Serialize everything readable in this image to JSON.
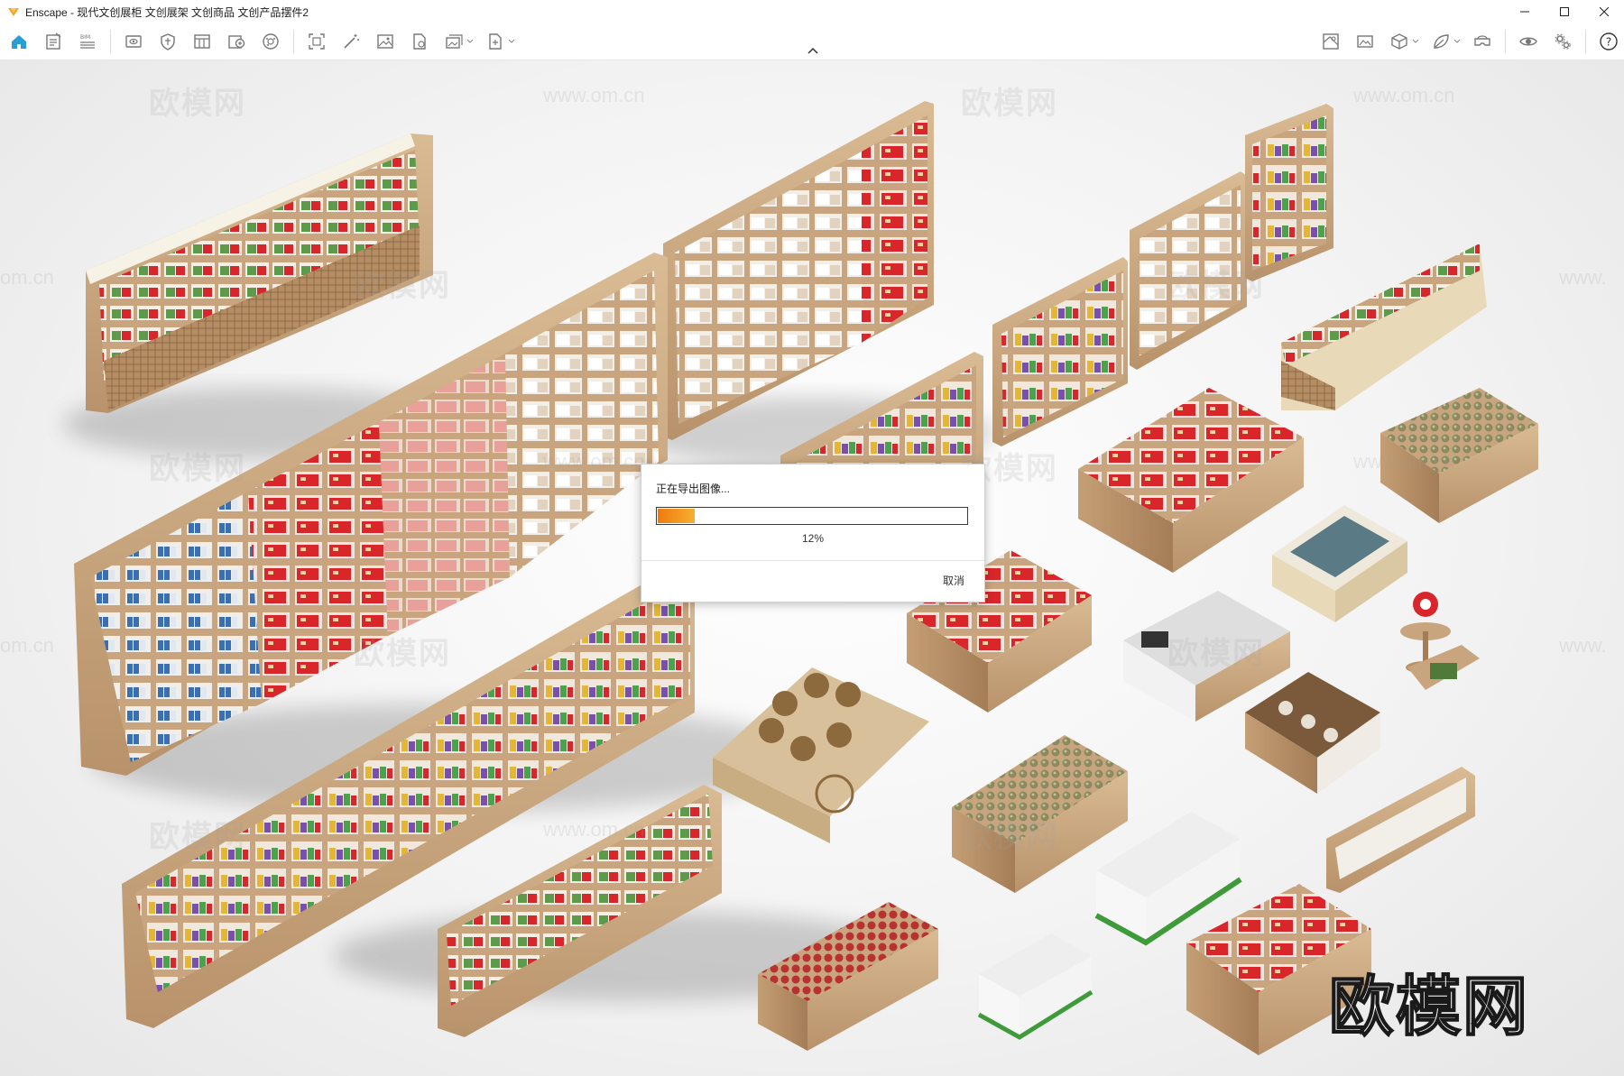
{
  "window": {
    "app_name": "Enscape",
    "title": "Enscape - 现代文创展柜 文创展架 文创商品 文创产品摆件2",
    "controls": [
      "minimize",
      "maximize",
      "close"
    ]
  },
  "toolbar": {
    "left_icons": [
      "home-icon",
      "notes-icon",
      "bim-icon",
      "view-icon",
      "shield-icon",
      "grid-panel-icon",
      "asset-library-icon",
      "material-editor-icon",
      "capture-icon",
      "magic-wand-icon",
      "image-icon",
      "export-file-icon",
      "batch-render-icon",
      "export-menu-icon"
    ],
    "right_icons": [
      "map-icon",
      "screenshot-icon",
      "cube-icon",
      "leaf-icon",
      "vr-headset-icon",
      "visibility-icon",
      "settings-icon",
      "help-icon"
    ],
    "help_label": "?"
  },
  "watermarks": {
    "text": "欧模网",
    "url": "www.om.cn",
    "url_fragment_left": "om.cn",
    "url_fragment_right": "www."
  },
  "brand": "欧模网",
  "dialog": {
    "title": "正在导出图像...",
    "progress": 0.12,
    "progress_label": "12%",
    "cancel_label": "取消"
  },
  "colors": {
    "accent": "#2a9fd6",
    "progress_start": "#f07a10",
    "progress_end": "#f5b030",
    "wood": "#c9a57f",
    "product_red": "#d8262b"
  }
}
